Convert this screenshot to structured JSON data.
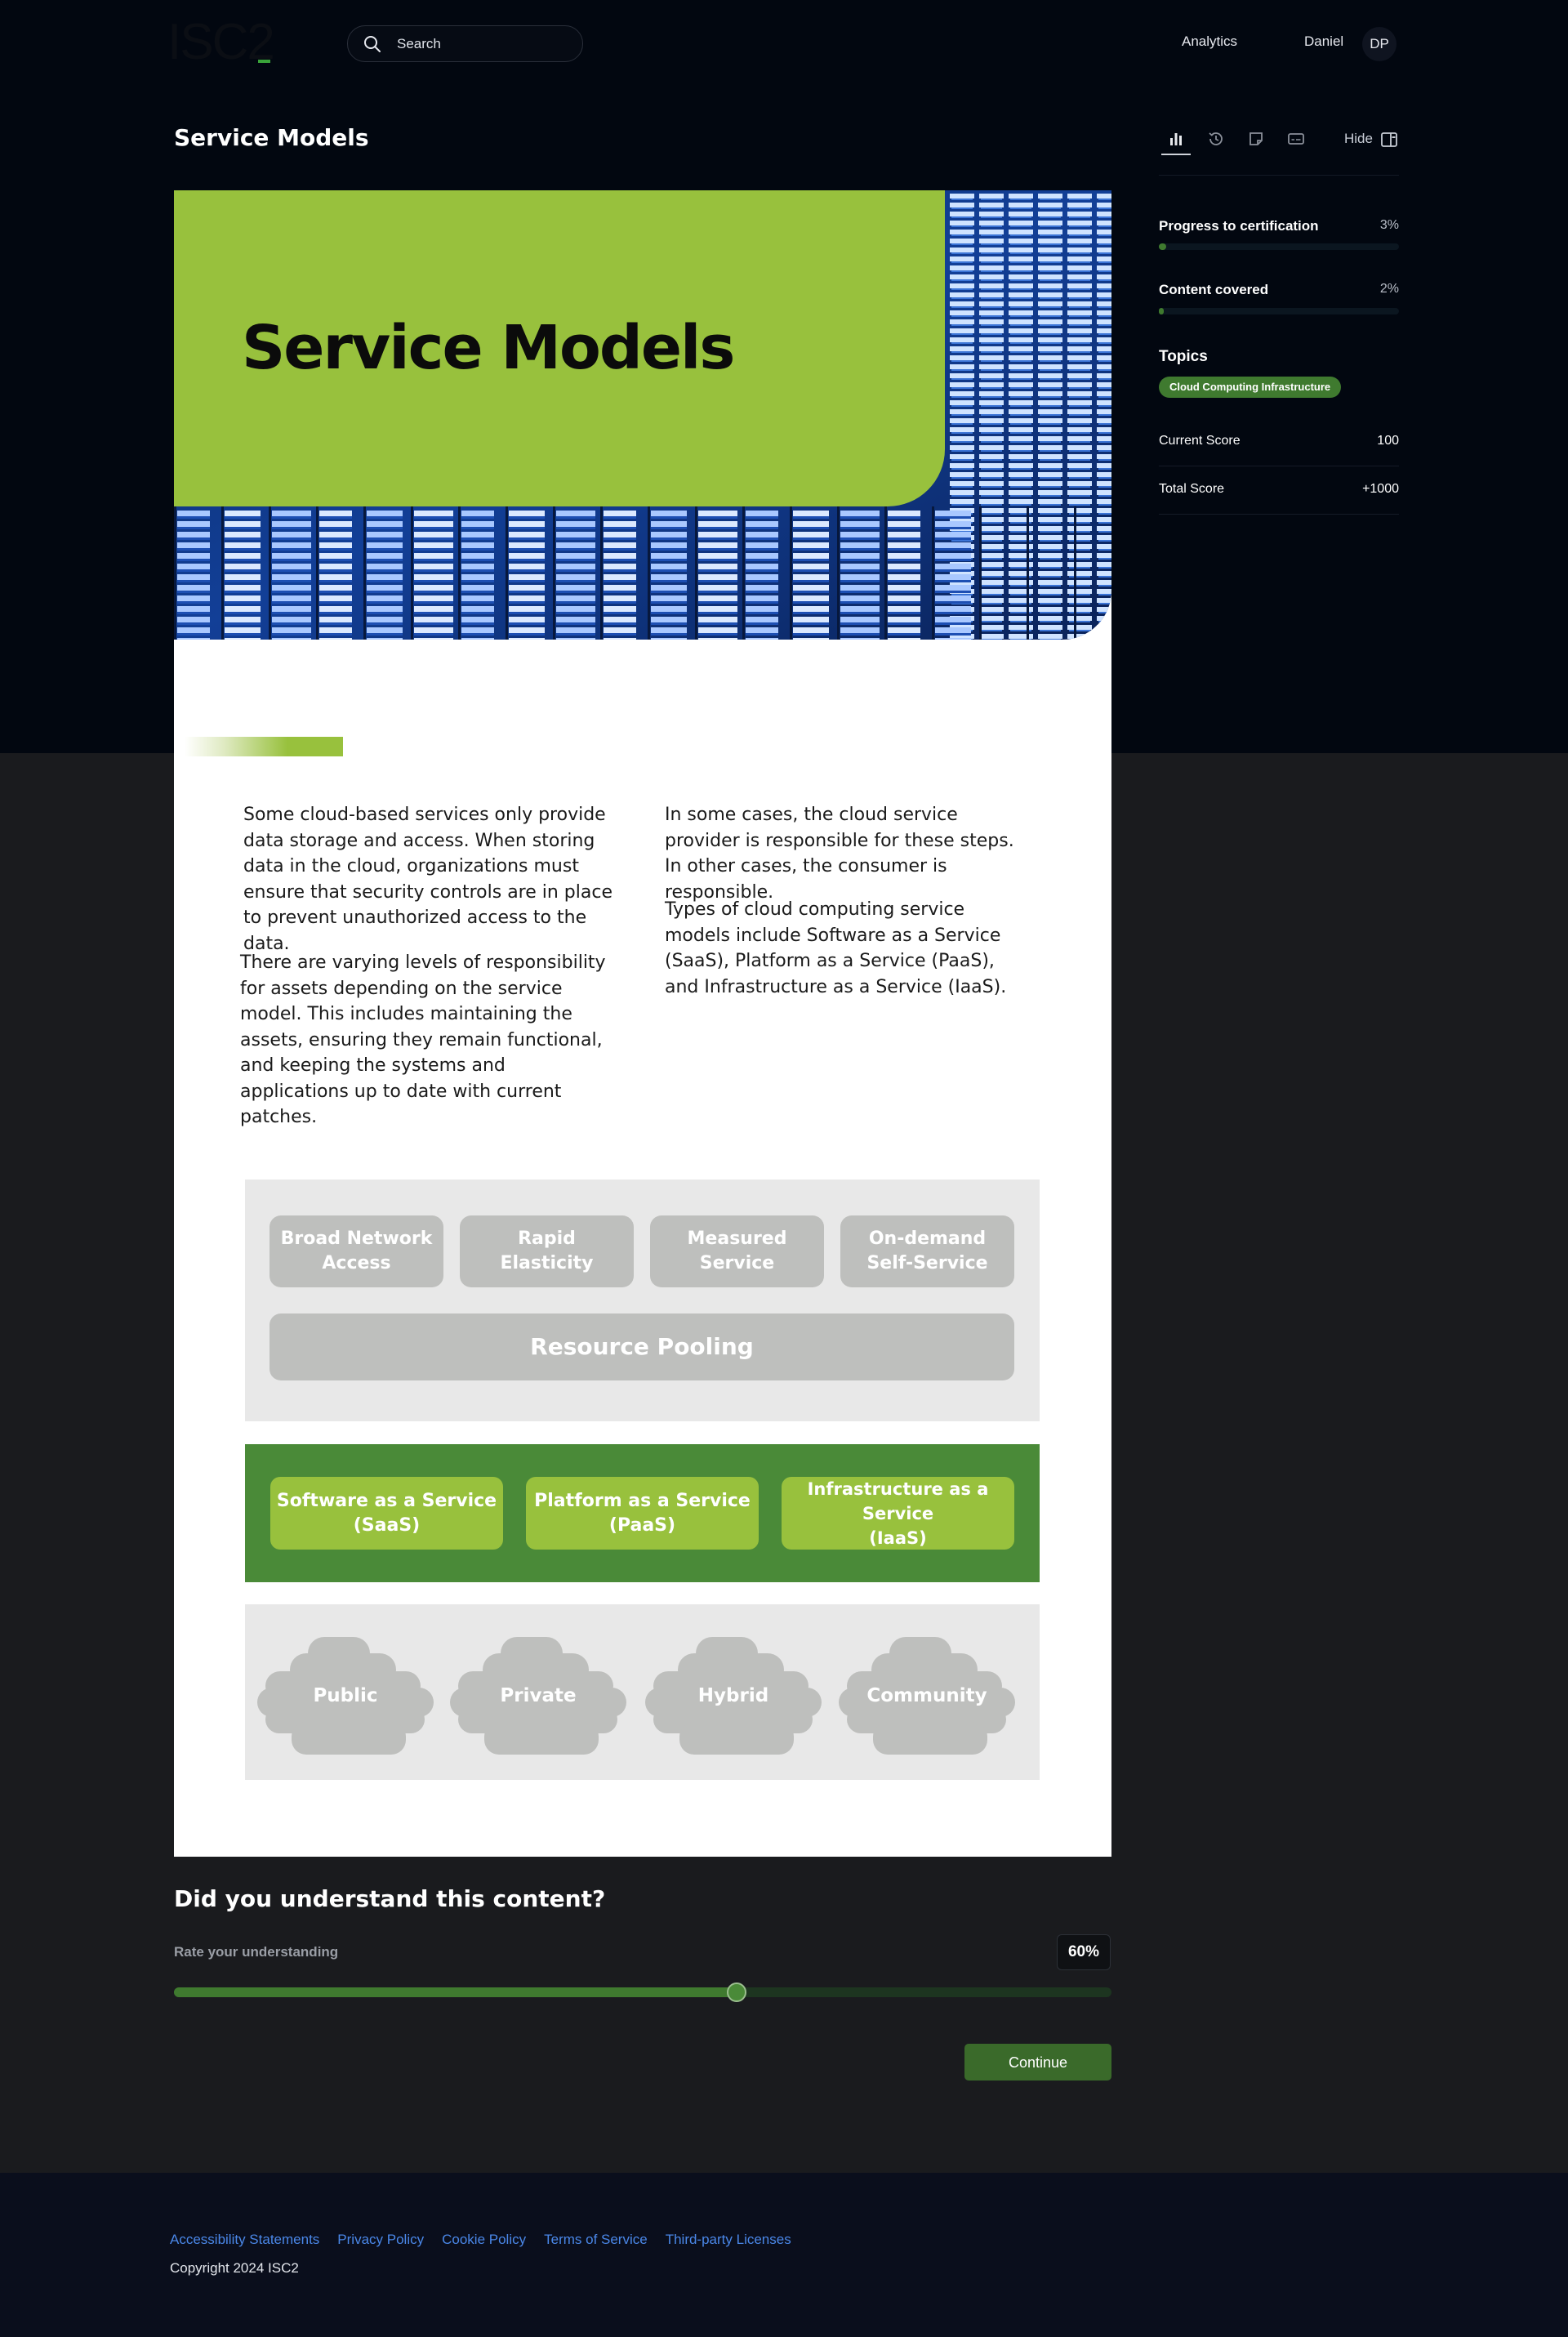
{
  "header": {
    "logo_text": "ISC2",
    "search_placeholder": "Search",
    "nav_analytics": "Analytics",
    "user_name": "Daniel",
    "user_initials": "DP"
  },
  "page": {
    "title": "Service Models",
    "toolbar": {
      "hide_label": "Hide",
      "icons": [
        "bar-chart-icon",
        "history-icon",
        "note-icon",
        "transcript-icon",
        "sidebar-toggle-icon"
      ]
    }
  },
  "sidebar": {
    "progress": {
      "label": "Progress to certification",
      "value_label": "3%",
      "fraction": 0.03
    },
    "content": {
      "label": "Content covered",
      "value_label": "2%",
      "fraction": 0.02
    },
    "topics_label": "Topics",
    "topics": [
      "Cloud Computing Infrastructure"
    ],
    "scores": [
      {
        "label": "Current Score",
        "value": "100"
      },
      {
        "label": "Total Score",
        "value": "+1000"
      }
    ]
  },
  "content": {
    "hero_title": "Service Models",
    "paragraphs": {
      "p1": "Some cloud-based services only provide data storage and access. When storing data in the cloud, organizations must ensure that security controls are in place to prevent unauthorized access to the data.",
      "p2": "There are varying levels of responsibility for assets depending on the service model. This includes maintaining the assets, ensuring they remain functional, and keeping the systems and applications up to date with current patches.",
      "p3": "In some cases, the cloud service provider is responsible for these steps. In other cases, the consumer is responsible.",
      "p4": "Types of cloud computing service models include Software as a Service (SaaS), Platform as a Service (PaaS), and Infrastructure as a Service (IaaS)."
    },
    "diagram": {
      "characteristics": {
        "c1_line1": "Broad Network",
        "c1_line2": "Access",
        "c2_line1": "Rapid",
        "c2_line2": "Elasticity",
        "c3_line1": "Measured",
        "c3_line2": "Service",
        "c4_line1": "On-demand",
        "c4_line2": "Self-Service",
        "pooling": "Resource Pooling"
      },
      "service_models": {
        "saas_line1": "Software as a Service",
        "saas_line2": "(SaaS)",
        "paas_line1": "Platform as a Service",
        "paas_line2": "(PaaS)",
        "iaas_line1": "Infrastructure as a Service",
        "iaas_line2": "(IaaS)"
      },
      "deployment_models": [
        "Public",
        "Private",
        "Hybrid",
        "Community"
      ],
      "colors": {
        "grey": "#bebfbd",
        "panel_grey": "#e8e8e8",
        "green_dark": "#4a8a38",
        "green_light": "#98c13d"
      }
    }
  },
  "rating": {
    "question": "Did you understand this content?",
    "label": "Rate your understanding",
    "value_label": "60%",
    "fraction": 0.6,
    "continue_label": "Continue"
  },
  "footer": {
    "links": [
      "Accessibility Statements",
      "Privacy Policy",
      "Cookie Policy",
      "Terms of Service",
      "Third-party Licenses"
    ],
    "copyright": "Copyright 2024 ISC2"
  }
}
